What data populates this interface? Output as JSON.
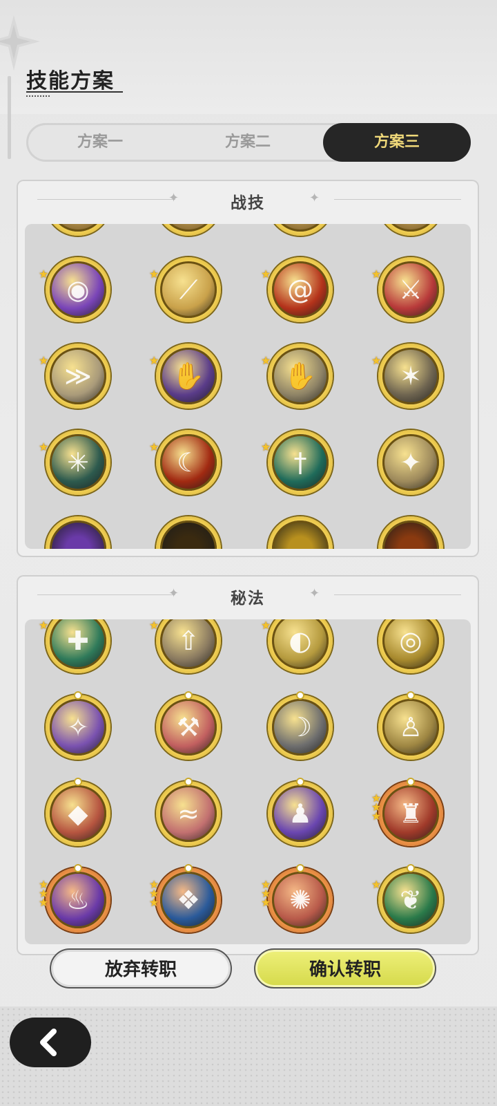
{
  "header": {
    "title": "技能方案"
  },
  "tabs": [
    {
      "label": "方案一",
      "active": false
    },
    {
      "label": "方案二",
      "active": false
    },
    {
      "label": "方案三",
      "active": true
    }
  ],
  "panels": {
    "combat": {
      "title": "战技"
    },
    "secret": {
      "title": "秘法"
    }
  },
  "combat_skills": [
    {
      "icon": "ghost-orb-icon",
      "color": "#7a45b8",
      "stars": 1,
      "glyph": "◉"
    },
    {
      "icon": "golden-slash-icon",
      "color": "#c9a14a",
      "stars": 1,
      "glyph": "⟋"
    },
    {
      "icon": "fire-swirl-icon",
      "color": "#b4331b",
      "stars": 1,
      "glyph": "@"
    },
    {
      "icon": "sword-raise-icon",
      "color": "#b83a3a",
      "stars": 1,
      "glyph": "⚔"
    },
    {
      "icon": "afterimage-dash-icon",
      "color": "#a99a7a",
      "stars": 1,
      "glyph": "≫"
    },
    {
      "icon": "shadow-claw-icon",
      "color": "#5a3c8a",
      "stars": 1,
      "glyph": "✋"
    },
    {
      "icon": "palm-strike-icon",
      "color": "#8e8366",
      "stars": 1,
      "glyph": "✋"
    },
    {
      "icon": "impact-hit-icon",
      "color": "#6e6450",
      "stars": 1,
      "glyph": "✶"
    },
    {
      "icon": "web-net-icon",
      "color": "#2d5a4e",
      "stars": 1,
      "glyph": "✳"
    },
    {
      "icon": "flame-arc-icon",
      "color": "#a12a12",
      "stars": 1,
      "glyph": "☾"
    },
    {
      "icon": "jade-sword-icon",
      "color": "#1f6b5a",
      "stars": 1,
      "glyph": "†"
    },
    {
      "icon": "light-blade-icon",
      "color": "#9e8a5c",
      "stars": 0,
      "glyph": "✦"
    }
  ],
  "secret_skills": [
    {
      "icon": "heal-circle-icon",
      "color": "#2f7a5a",
      "stars": 1,
      "glyph": "✚"
    },
    {
      "icon": "sword-buff-icon",
      "color": "#8a7a60",
      "stars": 1,
      "glyph": "⇧"
    },
    {
      "icon": "shield-heal-icon",
      "color": "#b59a3e",
      "stars": 1,
      "glyph": "◐"
    },
    {
      "icon": "eye-icon",
      "color": "#a88a2e",
      "stars": 0,
      "glyph": "◎"
    },
    {
      "icon": "purple-aura-icon",
      "color": "#7a52b0",
      "stars": 0,
      "glyph": "✧"
    },
    {
      "icon": "red-sword-plus-icon",
      "color": "#c26060",
      "stars": 0,
      "glyph": "⚒"
    },
    {
      "icon": "dodge-figure-icon",
      "color": "#6e6e6e",
      "stars": 0,
      "glyph": "☽"
    },
    {
      "icon": "golden-body-icon",
      "color": "#9e8642",
      "stars": 0,
      "glyph": "♙"
    },
    {
      "icon": "red-shard-icon",
      "color": "#b65540",
      "stars": 0,
      "glyph": "◆"
    },
    {
      "icon": "red-wind-icon",
      "color": "#c27070",
      "stars": 0,
      "glyph": "≈"
    },
    {
      "icon": "purple-figure-icon",
      "color": "#6a46b0",
      "stars": 0,
      "glyph": "♟"
    },
    {
      "icon": "red-armor-icon",
      "color": "#a03a2a",
      "stars": 3,
      "glyph": "♜"
    },
    {
      "icon": "violet-flame-icon",
      "color": "#6a3aa8",
      "stars": 3,
      "glyph": "♨"
    },
    {
      "icon": "blue-crystal-icon",
      "color": "#2a5a9a",
      "stars": 3,
      "glyph": "❖"
    },
    {
      "icon": "red-burst-icon",
      "color": "#b85a4a",
      "stars": 3,
      "glyph": "✺"
    },
    {
      "icon": "green-leaf-icon",
      "color": "#2a7a4a",
      "stars": 1,
      "glyph": "❦"
    }
  ],
  "buttons": {
    "cancel": "放弃转职",
    "confirm": "确认转职"
  },
  "icons": {
    "back": "back-arrow-icon"
  }
}
